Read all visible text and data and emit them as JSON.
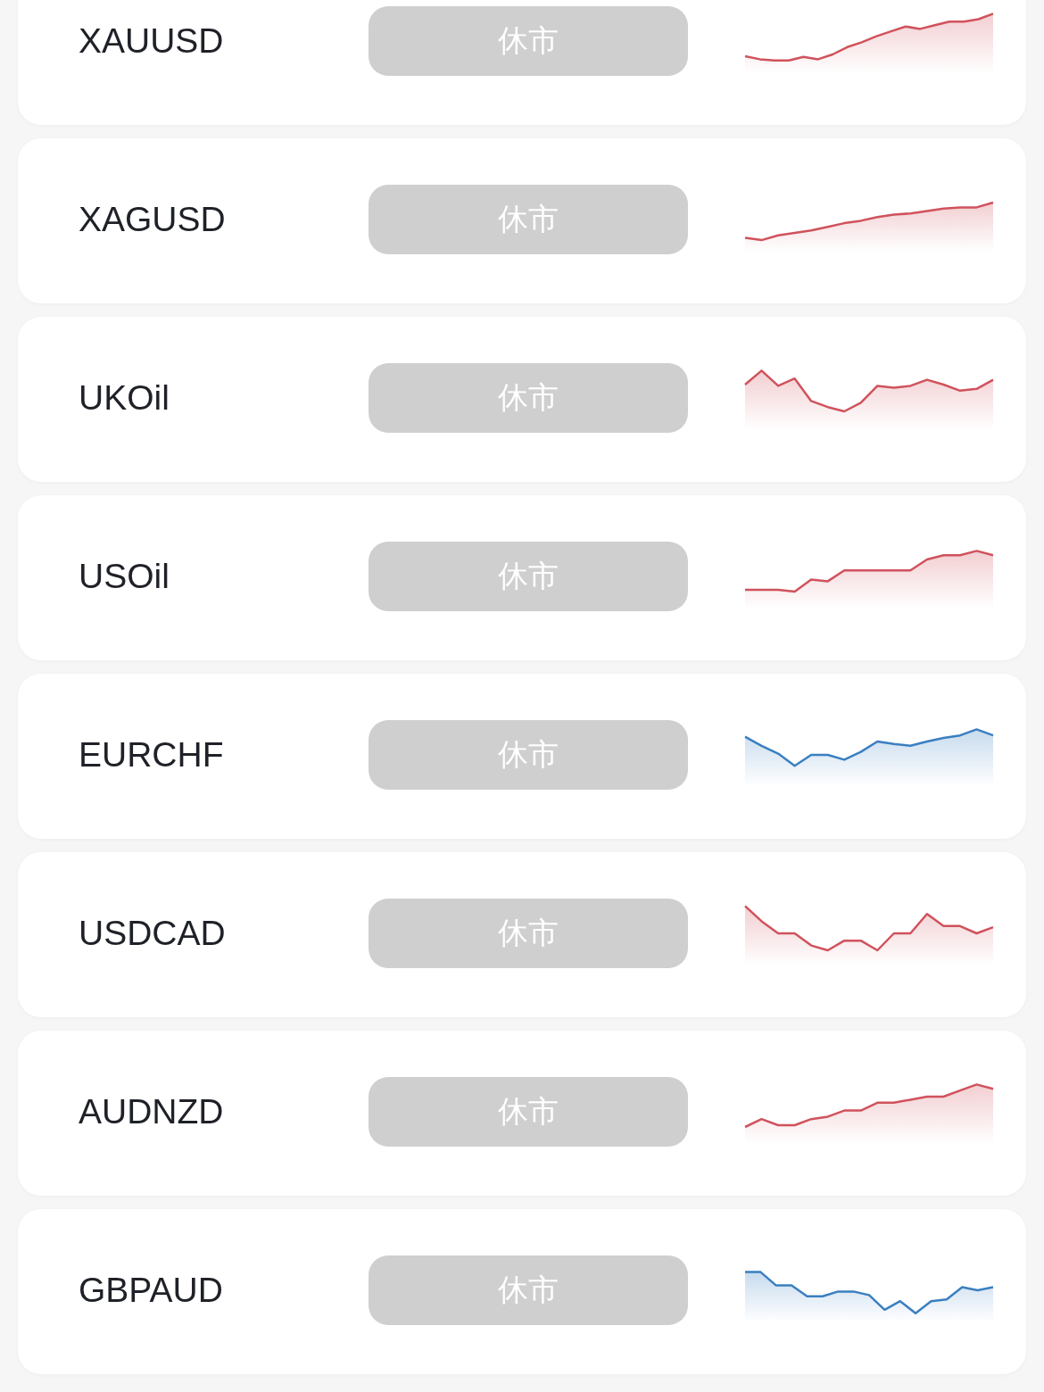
{
  "quotes": [
    {
      "symbol": "XAUUSD",
      "status": "休市",
      "color": "#d0525c"
    },
    {
      "symbol": "XAGUSD",
      "status": "休市",
      "color": "#d0525c"
    },
    {
      "symbol": "UKOil",
      "status": "休市",
      "color": "#d0525c"
    },
    {
      "symbol": "USOil",
      "status": "休市",
      "color": "#d0525c"
    },
    {
      "symbol": "EURCHF",
      "status": "休市",
      "color": "#3a7fc0"
    },
    {
      "symbol": "USDCAD",
      "status": "休市",
      "color": "#d0525c"
    },
    {
      "symbol": "AUDNZD",
      "status": "休市",
      "color": "#d0525c"
    },
    {
      "symbol": "GBPAUD",
      "status": "休市",
      "color": "#3a7fc0"
    }
  ]
}
